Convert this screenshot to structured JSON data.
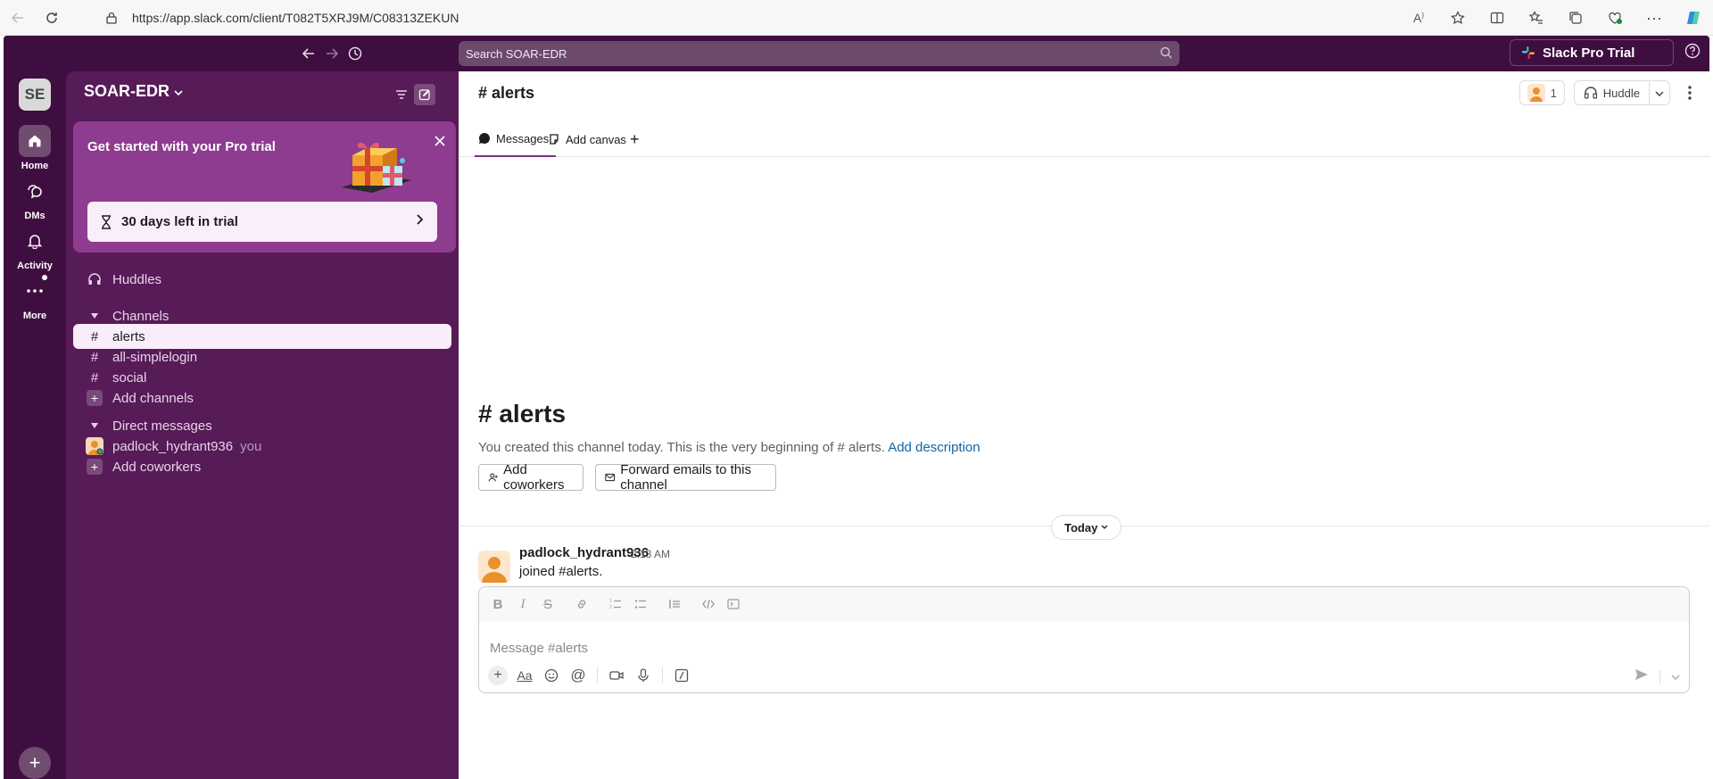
{
  "browser": {
    "url": "https://app.slack.com/client/T082T5XRJ9M/C08313ZEKUN"
  },
  "topnav": {
    "search_placeholder": "Search SOAR-EDR",
    "pro_trial_label": "Slack Pro Trial"
  },
  "rail": {
    "workspace_initials": "SE",
    "items": [
      {
        "label": "Home"
      },
      {
        "label": "DMs"
      },
      {
        "label": "Activity"
      },
      {
        "label": "More"
      }
    ]
  },
  "sidebar": {
    "workspace_name": "SOAR-EDR",
    "promo": {
      "title": "Get started with your Pro trial",
      "button_label": "30 days left in trial"
    },
    "huddles_label": "Huddles",
    "channels_header": "Channels",
    "channels": [
      {
        "name": "alerts"
      },
      {
        "name": "all-simplelogin"
      },
      {
        "name": "social"
      }
    ],
    "add_channels_label": "Add channels",
    "dm_header": "Direct messages",
    "dm_user": "padlock_hydrant936",
    "dm_you": "you",
    "add_coworkers_label": "Add coworkers"
  },
  "main": {
    "channel_title": "alerts",
    "member_count": "1",
    "huddle_label": "Huddle",
    "tabs": [
      {
        "label": "Messages"
      },
      {
        "label": "Add canvas"
      }
    ],
    "intro": {
      "title": "alerts",
      "text_prefix": "You created this channel today. This is the very beginning of",
      "text_channel": "# alerts.",
      "add_description": "Add description",
      "add_coworkers_btn": "Add coworkers",
      "forward_emails_btn": "Forward emails to this channel"
    },
    "divider_label": "Today",
    "message": {
      "author": "padlock_hydrant936",
      "time": "2:13 AM",
      "text": "joined #alerts."
    },
    "composer": {
      "placeholder": "Message #alerts"
    }
  },
  "colors": {
    "aubergine": "#3f0e40",
    "sidebar": "#571b58",
    "promo": "#8d3c8f",
    "link": "#1264a3"
  }
}
